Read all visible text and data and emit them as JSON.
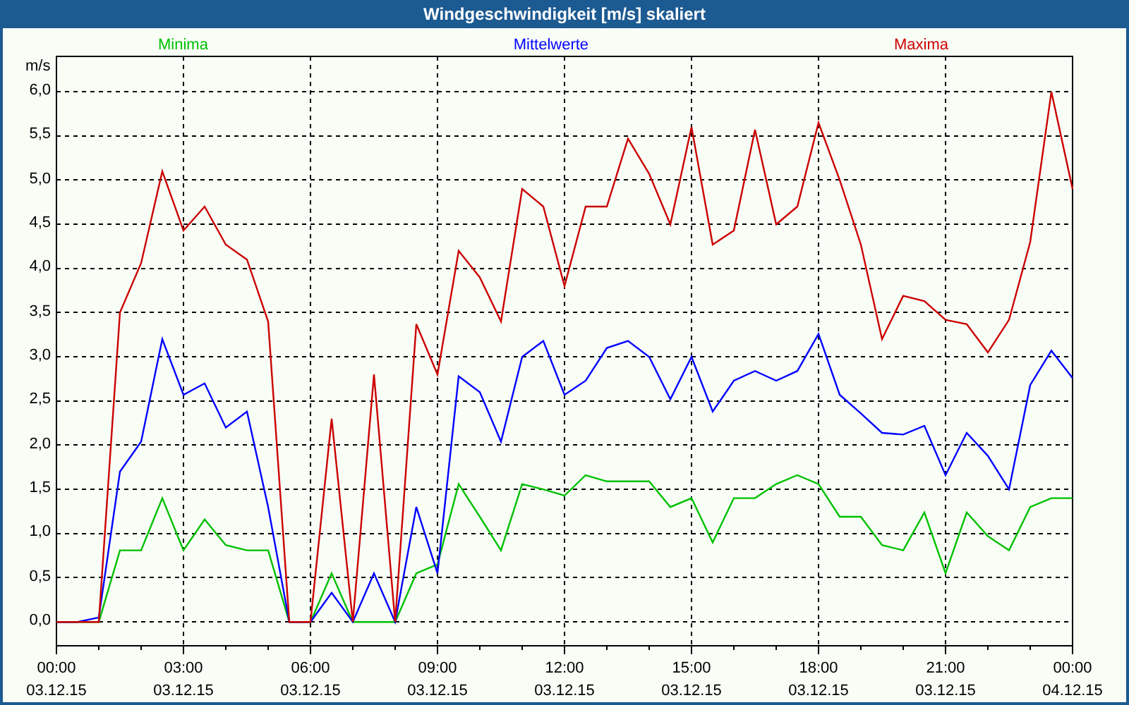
{
  "window": {
    "title": "Windgeschwindigkeit [m/s] skaliert"
  },
  "chart": {
    "chart_data": {
      "type": "line",
      "ylabel": "m/s",
      "categories": [
        "00:00 03.12.15",
        null,
        null,
        null,
        null,
        null,
        "03:00 03.12.15",
        null,
        null,
        null,
        null,
        null,
        "06:00 03.12.15",
        null,
        null,
        null,
        null,
        null,
        "09:00 03.12.15",
        null,
        null,
        null,
        null,
        null,
        "12:00 03.12.15",
        null,
        null,
        null,
        null,
        null,
        "15:00 03.12.15",
        null,
        null,
        null,
        null,
        null,
        "18:00 03.12.15",
        null,
        null,
        null,
        null,
        null,
        "21:00 03.12.15",
        null,
        null,
        null,
        null,
        null,
        "00:00 04.12.15"
      ],
      "ylim": [
        -0.27,
        6.4
      ],
      "grid": true,
      "yticks": [
        {
          "value": 0,
          "label": "0,0"
        },
        {
          "value": 0.5,
          "label": "0,5"
        },
        {
          "value": 1,
          "label": "1,0"
        },
        {
          "value": 1.5,
          "label": "1,5"
        },
        {
          "value": 2,
          "label": "2,0"
        },
        {
          "value": 2.5,
          "label": "2,5"
        },
        {
          "value": 3,
          "label": "3,0"
        },
        {
          "value": 3.5,
          "label": "3,5"
        },
        {
          "value": 4,
          "label": "4,0"
        },
        {
          "value": 4.5,
          "label": "4,5"
        },
        {
          "value": 5,
          "label": "5,0"
        },
        {
          "value": 5.5,
          "label": "5,5"
        },
        {
          "value": 6,
          "label": "6,0"
        }
      ],
      "series": [
        {
          "name": "Minima",
          "color": "#00c000",
          "values": [
            0,
            0,
            0,
            0.81,
            0.81,
            1.4,
            0.81,
            1.16,
            0.87,
            0.81,
            0.81,
            0,
            0,
            0.55,
            0,
            0,
            0,
            0.55,
            0.65,
            1.56,
            1.19,
            0.81,
            1.56,
            1.5,
            1.43,
            1.66,
            1.59,
            1.59,
            1.59,
            1.3,
            1.4,
            0.9,
            1.4,
            1.4,
            1.56,
            1.66,
            1.56,
            1.19,
            1.19,
            0.87,
            0.81,
            1.24,
            0.55,
            1.24,
            0.97,
            0.81,
            1.3,
            1.4,
            1.4
          ]
        },
        {
          "name": "Mittelwerte",
          "color": "#0000ff",
          "values": [
            0,
            0,
            0.05,
            1.7,
            2.04,
            3.2,
            2.57,
            2.7,
            2.2,
            2.38,
            1.3,
            0,
            0,
            0.33,
            0,
            0.55,
            0,
            1.3,
            0.55,
            2.78,
            2.6,
            2.04,
            3.0,
            3.18,
            2.57,
            2.73,
            3.1,
            3.18,
            3.0,
            2.52,
            3.0,
            2.38,
            2.73,
            2.84,
            2.73,
            2.84,
            3.26,
            2.57,
            2.36,
            2.14,
            2.12,
            2.22,
            1.66,
            2.14,
            1.88,
            1.5,
            2.68,
            3.07,
            2.76
          ]
        },
        {
          "name": "Maxima",
          "color": "#cc0000",
          "values": [
            0,
            0,
            0,
            3.5,
            4.06,
            5.1,
            4.43,
            4.7,
            4.27,
            4.1,
            3.4,
            0,
            0,
            2.3,
            0,
            2.8,
            0,
            3.37,
            2.8,
            4.2,
            3.9,
            3.4,
            4.9,
            4.7,
            3.8,
            4.7,
            4.7,
            5.47,
            5.07,
            4.5,
            5.6,
            4.27,
            4.43,
            5.57,
            4.5,
            4.7,
            5.65,
            5.0,
            4.27,
            3.2,
            3.69,
            3.63,
            3.42,
            3.37,
            3.05,
            3.42,
            4.3,
            6.0,
            4.9
          ]
        }
      ]
    }
  }
}
